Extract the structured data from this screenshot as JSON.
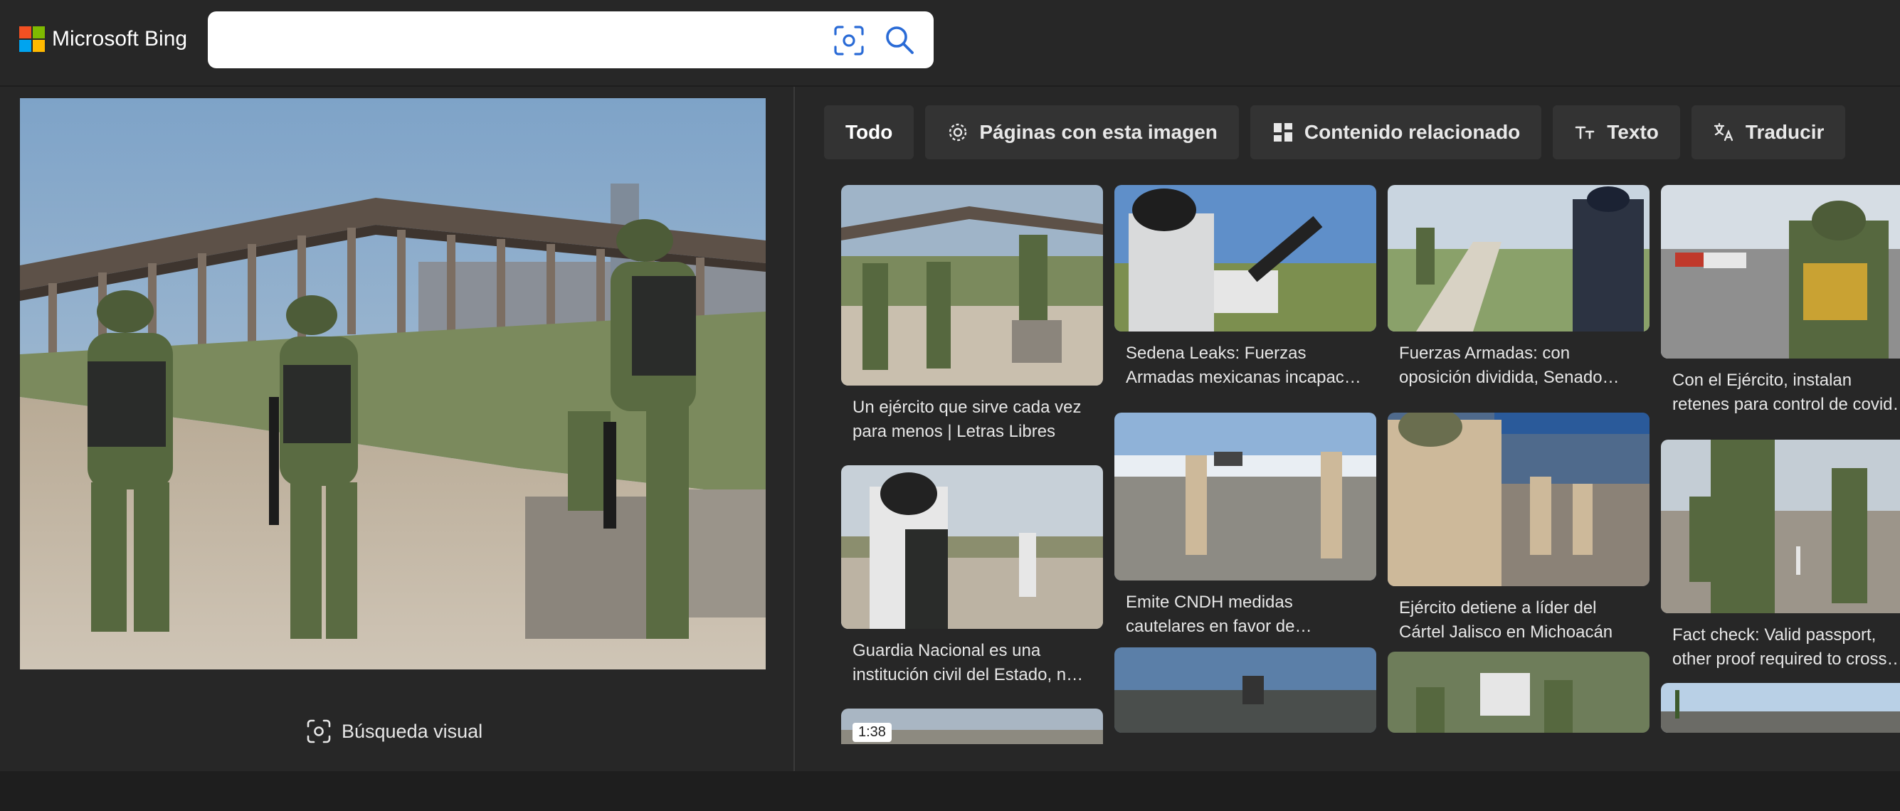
{
  "header": {
    "brand": "Microsoft Bing",
    "search_value": "",
    "brand_colors": [
      "#f25022",
      "#7fba00",
      "#00a4ef",
      "#ffb900"
    ],
    "icons": [
      "visual-search-icon",
      "search-icon"
    ]
  },
  "preview": {
    "visual_search_label": "Búsqueda visual"
  },
  "tabs": [
    {
      "label": "Todo",
      "icon": ""
    },
    {
      "label": "Páginas con esta imagen",
      "icon": "globe-icon"
    },
    {
      "label": "Contenido relacionado",
      "icon": "grid-icon"
    },
    {
      "label": "Texto",
      "icon": "text-icon"
    },
    {
      "label": "Traducir",
      "icon": "translate-icon"
    }
  ],
  "results": [
    {
      "caption": "Un ejército que sirve cada vez para menos | Letras Libres"
    },
    {
      "caption": "Guardia Nacional es una institución civil del Estado, n…"
    },
    {
      "caption": "",
      "duration": "1:38"
    },
    {
      "caption": "Sedena Leaks: Fuerzas Armadas mexicanas incapac…"
    },
    {
      "caption": "Emite CNDH medidas cautelares en favor de…"
    },
    {
      "caption": ""
    },
    {
      "caption": "Fuerzas Armadas: con oposición dividida, Senado…"
    },
    {
      "caption": "Ejército detiene a líder del Cártel Jalisco en Michoacán"
    },
    {
      "caption": ""
    },
    {
      "caption": "Con el Ejército, instalan retenes para control de covid…"
    },
    {
      "caption": "Fact check: Valid passport, other proof required to cross…"
    },
    {
      "caption": ""
    }
  ],
  "colors": {
    "background": "#272727",
    "tab_background": "#333333",
    "accent_icon": "#2a6bd6"
  }
}
